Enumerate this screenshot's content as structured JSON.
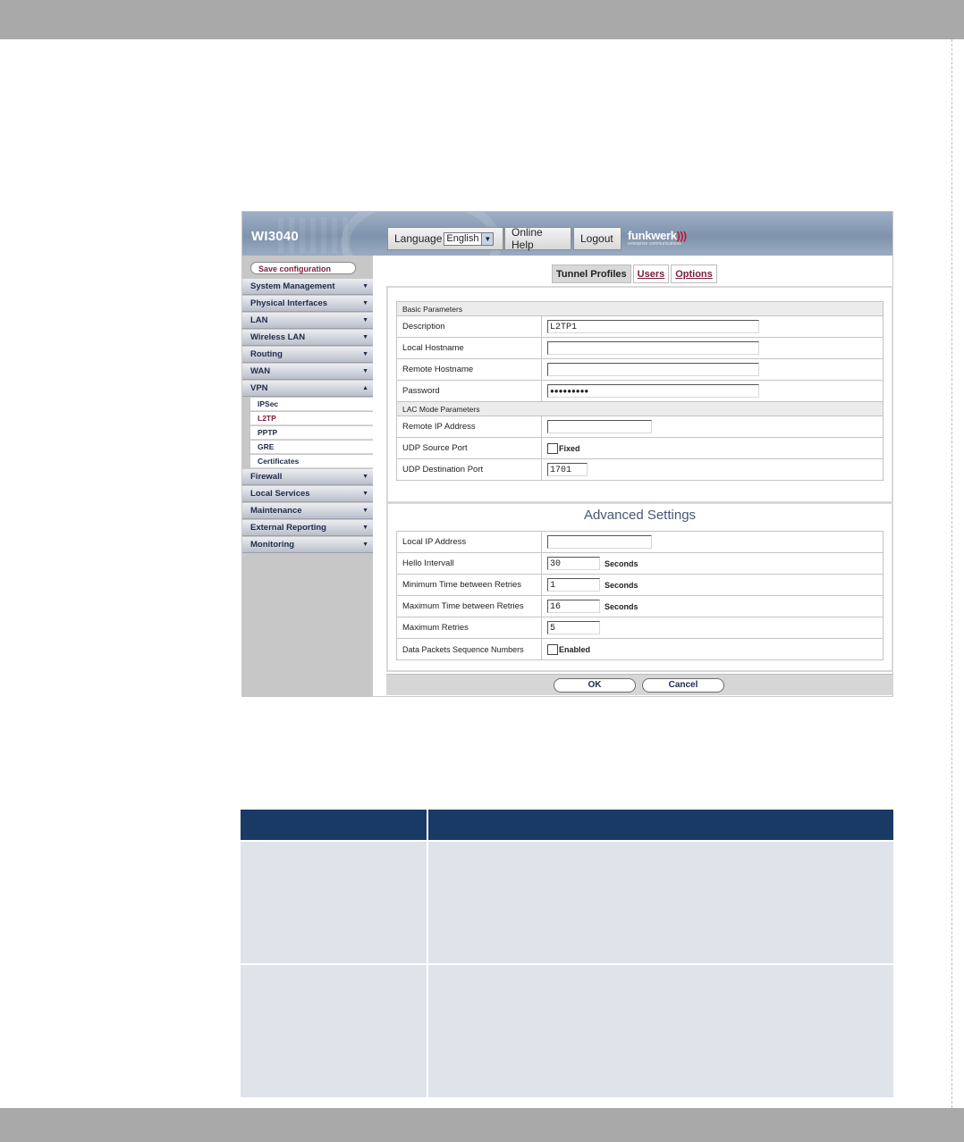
{
  "app": {
    "product": "WI3040",
    "language_label": "Language",
    "language_value": "English",
    "online_help": "Online Help",
    "logout": "Logout",
    "logo_text": "funkwerk",
    "logo_waves": ")))",
    "logo_tagline": "enterprise communications"
  },
  "sidebar": {
    "save_label": "Save configuration",
    "items": [
      {
        "label": "System Management"
      },
      {
        "label": "Physical Interfaces"
      },
      {
        "label": "LAN"
      },
      {
        "label": "Wireless LAN"
      },
      {
        "label": "Routing"
      },
      {
        "label": "WAN"
      },
      {
        "label": "VPN",
        "expanded": true
      }
    ],
    "vpn_sub": [
      {
        "label": "IPSec"
      },
      {
        "label": "L2TP",
        "active": true
      },
      {
        "label": "PPTP"
      },
      {
        "label": "GRE"
      },
      {
        "label": "Certificates"
      }
    ],
    "items_after": [
      {
        "label": "Firewall"
      },
      {
        "label": "Local Services"
      },
      {
        "label": "Maintenance"
      },
      {
        "label": "External Reporting"
      },
      {
        "label": "Monitoring"
      }
    ]
  },
  "tabs": [
    {
      "label": "Tunnel Profiles",
      "active": true
    },
    {
      "label": "Users"
    },
    {
      "label": "Options"
    }
  ],
  "form": {
    "basic_section": "Basic Parameters",
    "description_label": "Description",
    "description_value": "L2TP1",
    "local_hostname_label": "Local Hostname",
    "local_hostname_value": "",
    "remote_hostname_label": "Remote Hostname",
    "remote_hostname_value": "",
    "password_label": "Password",
    "password_value": "●●●●●●●●●",
    "lac_section": "LAC Mode Parameters",
    "remote_ip_label": "Remote IP Address",
    "remote_ip_value": "",
    "udp_source_label": "UDP Source Port",
    "udp_source_fixed": "Fixed",
    "udp_dest_label": "UDP Destination Port",
    "udp_dest_value": "1701"
  },
  "advanced": {
    "title": "Advanced Settings",
    "local_ip_label": "Local IP Address",
    "local_ip_value": "",
    "hello_label": "Hello Intervall",
    "hello_value": "30",
    "min_retry_label": "Minimum Time between Retries",
    "min_retry_value": "1",
    "max_retry_label": "Maximum Time between Retries",
    "max_retry_value": "16",
    "max_retries_label": "Maximum Retries",
    "max_retries_value": "5",
    "seq_label": "Data Packets Sequence Numbers",
    "seq_enabled": "Enabled",
    "seconds": "Seconds"
  },
  "buttons": {
    "ok": "OK",
    "cancel": "Cancel"
  },
  "colors": {
    "accent": "#7a1d3a",
    "nav_text": "#1e2b4a",
    "table_header": "#1a3a66",
    "table_row": "#dfe3ea"
  }
}
